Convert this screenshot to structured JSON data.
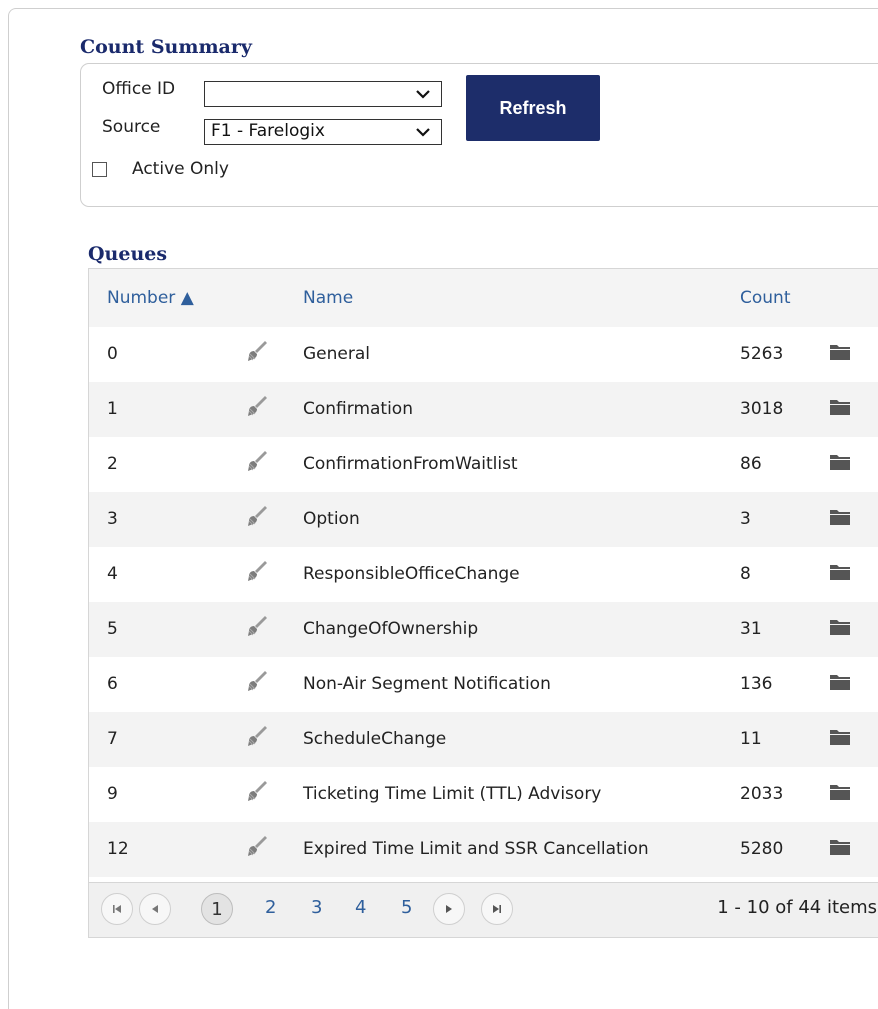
{
  "count_summary": {
    "title": "Count Summary",
    "office_id_label": "Office ID",
    "office_id_value": "",
    "source_label": "Source",
    "source_value": "F1 - Farelogix",
    "refresh_label": "Refresh",
    "active_only_label": "Active Only",
    "active_only_checked": false
  },
  "queues": {
    "title": "Queues",
    "columns": {
      "number": "Number ▲",
      "name": "Name",
      "count": "Count"
    },
    "rows": [
      {
        "number": "0",
        "name": "General",
        "count": "5263"
      },
      {
        "number": "1",
        "name": "Confirmation",
        "count": "3018"
      },
      {
        "number": "2",
        "name": "ConfirmationFromWaitlist",
        "count": "86"
      },
      {
        "number": "3",
        "name": "Option",
        "count": "3"
      },
      {
        "number": "4",
        "name": "ResponsibleOfficeChange",
        "count": "8"
      },
      {
        "number": "5",
        "name": "ChangeOfOwnership",
        "count": "31"
      },
      {
        "number": "6",
        "name": "Non-Air Segment Notification",
        "count": "136"
      },
      {
        "number": "7",
        "name": "ScheduleChange",
        "count": "11"
      },
      {
        "number": "9",
        "name": "Ticketing Time Limit (TTL) Advisory",
        "count": "2033"
      },
      {
        "number": "12",
        "name": "Expired Time Limit and SSR Cancellation",
        "count": "5280"
      }
    ],
    "row_icons": {
      "action": "brush-icon",
      "open": "folder-icon"
    }
  },
  "pager": {
    "pages": [
      "1",
      "2",
      "3",
      "4",
      "5"
    ],
    "current_page": "1",
    "info": "1 - 10 of 44 items"
  },
  "colors": {
    "title": "#1a2a6c",
    "button": "#1d2d6a",
    "link": "#2f5f9c"
  }
}
